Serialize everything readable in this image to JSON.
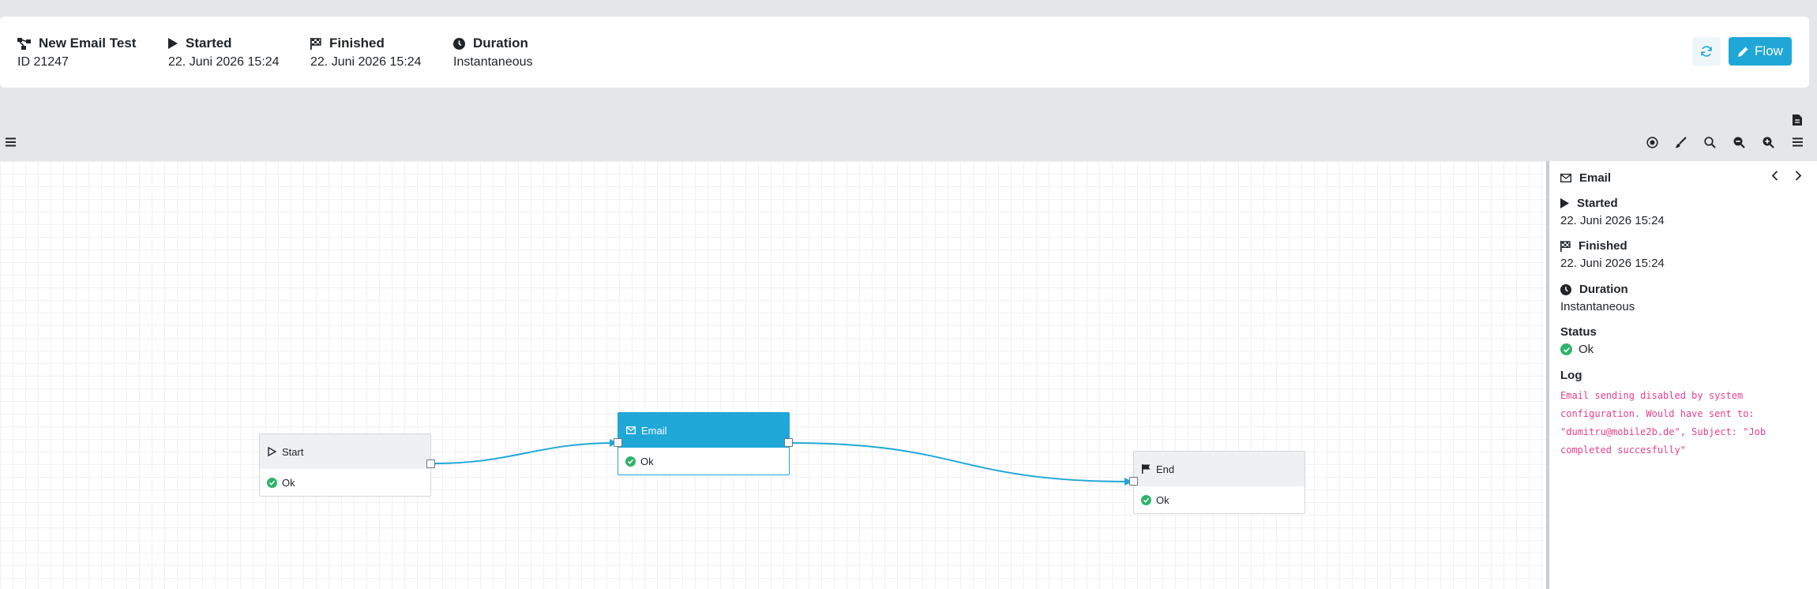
{
  "header": {
    "job": {
      "title": "New Email Test",
      "id_text": "ID 21247"
    },
    "started": {
      "label": "Started",
      "value": "22. Juni 2026 15:24"
    },
    "finished": {
      "label": "Finished",
      "value": "22. Juni 2026 15:24"
    },
    "duration": {
      "label": "Duration",
      "value": "Instantaneous"
    },
    "flow_button_label": "Flow"
  },
  "colors": {
    "accent": "#1fa7d8",
    "ok": "#2fb36b",
    "log": "#e83e8c"
  },
  "nodes": [
    {
      "name": "Start",
      "status": "Ok",
      "icon": "play-outline-icon"
    },
    {
      "name": "Email",
      "status": "Ok",
      "icon": "envelope-icon"
    },
    {
      "name": "End",
      "status": "Ok",
      "icon": "flag-icon"
    }
  ],
  "panel": {
    "node_title": "Email",
    "started": {
      "label": "Started",
      "value": "22. Juni 2026 15:24"
    },
    "finished": {
      "label": "Finished",
      "value": "22. Juni 2026 15:24"
    },
    "duration": {
      "label": "Duration",
      "value": "Instantaneous"
    },
    "status": {
      "label": "Status",
      "value": "Ok"
    },
    "log": {
      "label": "Log",
      "lines": [
        "Email sending disabled by system",
        "configuration. Would have sent to:",
        "\"dumitru@mobile2b.de\", Subject: \"Job",
        "completed succesfully\""
      ]
    }
  }
}
